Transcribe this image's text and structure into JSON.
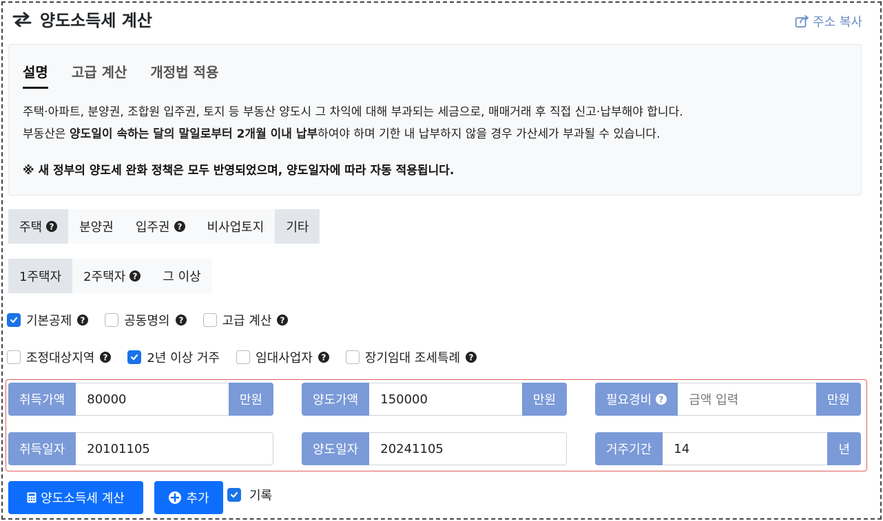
{
  "header": {
    "title": "양도소득세 계산",
    "copy_link": "주소 복사"
  },
  "info": {
    "tabs": [
      {
        "label": "설명",
        "active": true
      },
      {
        "label": "고급 계산",
        "active": false
      },
      {
        "label": "개정법 적용",
        "active": false
      }
    ],
    "desc_line1": "주택·아파트, 분양권, 조합원 입주권, 토지 등 부동산 양도시 그 차익에 대해 부과되는 세금으로, 매매거래 후 직접 신고·납부해야 합니다.",
    "desc_line2_pre": "부동산은 ",
    "desc_line2_bold": "양도일이 속하는 달의 말일로부터 2개월 이내 납부",
    "desc_line2_post": "하여야 하며 기한 내 납부하지 않을 경우 가산세가 부과될 수 있습니다.",
    "notice": "※ 새 정부의 양도세 완화 정책은 모두 반영되었으며, 양도일자에 따라 자동 적용됩니다."
  },
  "property_types": {
    "items": [
      "주택",
      "분양권",
      "입주권",
      "비사업토지",
      "기타"
    ],
    "selected": "주택"
  },
  "house_counts": {
    "items": [
      "1주택자",
      "2주택자",
      "그 이상"
    ],
    "selected": "1주택자"
  },
  "options_row1": [
    {
      "label": "기본공제",
      "checked": true
    },
    {
      "label": "공동명의",
      "checked": false
    },
    {
      "label": "고급 계산",
      "checked": false
    }
  ],
  "options_row2": [
    {
      "label": "조정대상지역",
      "checked": false
    },
    {
      "label": "2년 이상 거주",
      "checked": true
    },
    {
      "label": "임대사업자",
      "checked": false
    },
    {
      "label": "장기임대 조세특례",
      "checked": false
    }
  ],
  "inputs": {
    "acq_price": {
      "label": "취득가액",
      "value": "80000",
      "unit": "만원"
    },
    "sale_price": {
      "label": "양도가액",
      "value": "150000",
      "unit": "만원"
    },
    "expense": {
      "label": "필요경비",
      "placeholder": "금액 입력",
      "unit": "만원"
    },
    "acq_date": {
      "label": "취득일자",
      "value": "20101105"
    },
    "sale_date": {
      "label": "양도일자",
      "value": "20241105"
    },
    "residence": {
      "label": "거주기간",
      "value": "14",
      "unit": "년"
    }
  },
  "actions": {
    "calc_label": "양도소득세 계산",
    "add_label": "추가",
    "record_label": "기록",
    "record_checked": true
  },
  "colors": {
    "accent": "#0d6efd",
    "input_addon": "#7b9ad8",
    "highlight_border": "#e05c5c"
  }
}
